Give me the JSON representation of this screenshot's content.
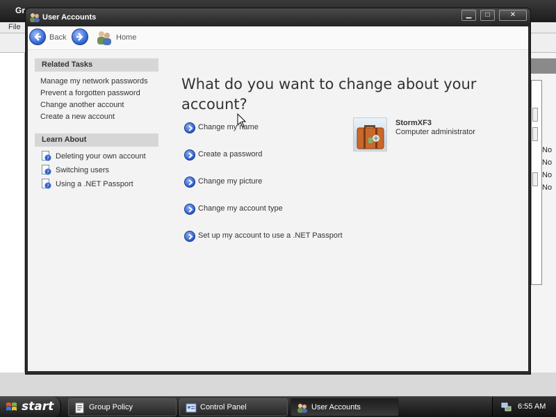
{
  "background": {
    "title": "Gr",
    "menu_file": "File",
    "right_texts": [
      "No",
      "No",
      "No",
      "No"
    ]
  },
  "window": {
    "title": "User Accounts",
    "min_label": "▁",
    "max_label": "□",
    "close_label": "✕"
  },
  "nav": {
    "back_label": "Back",
    "home_label": "Home"
  },
  "related_tasks": {
    "header": "Related Tasks",
    "items": [
      "Manage my network passwords",
      "Prevent a forgotten password",
      "Change another account",
      "Create a new account"
    ]
  },
  "learn_about": {
    "header": "Learn About",
    "items": [
      "Deleting your own account",
      "Switching users",
      "Using a .NET Passport"
    ]
  },
  "main": {
    "heading": "What do you want to change about your account?",
    "actions": [
      "Change my name",
      "Create a password",
      "Change my picture",
      "Change my account type",
      "Set up my account to use a .NET Passport"
    ]
  },
  "account": {
    "name": "StormXF3",
    "role": "Computer administrator",
    "picture": "suitcase-picture"
  },
  "taskbar": {
    "start_label": "start",
    "tasks": [
      "Group Policy",
      "Control Panel",
      "User Accounts"
    ],
    "active_task": "User Accounts",
    "clock": "6:55 AM"
  },
  "colors": {
    "accent_blue": "#2b5ac9",
    "titlebar": "#2b2b2b",
    "panel_header": "#d6d6d6",
    "content_bg": "#f3f3f3"
  }
}
